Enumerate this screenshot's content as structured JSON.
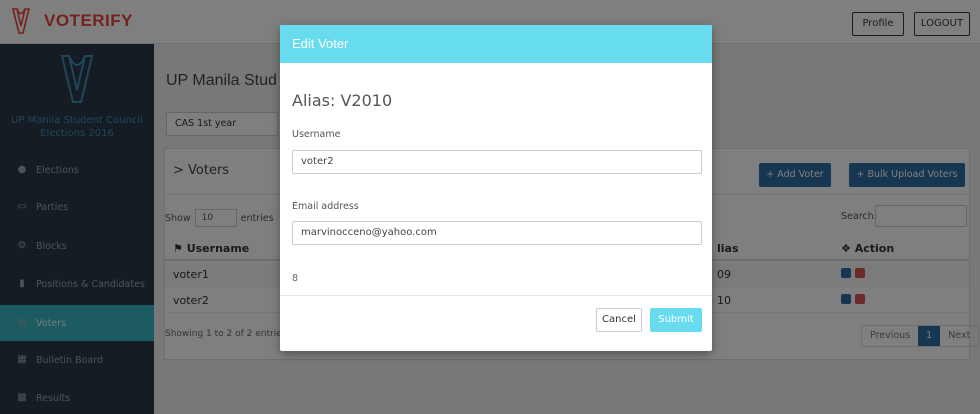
{
  "app": {
    "brand": "VOTERIFY"
  },
  "header": {
    "profile_label": "Profile",
    "logout_label": "LOGOUT"
  },
  "sidebar": {
    "title": "UP Manila Student Council Elections 2016",
    "items": [
      {
        "label": "Elections",
        "icon": "users-icon"
      },
      {
        "label": "Parties",
        "icon": "monitor-icon"
      },
      {
        "label": "Blocks",
        "icon": "cogs-icon"
      },
      {
        "label": "Positions & Candidates",
        "icon": "book-icon"
      },
      {
        "label": "Voters",
        "icon": "id-card-icon",
        "active": true
      },
      {
        "label": "Bulletin Board",
        "icon": "grid-icon"
      },
      {
        "label": "Results",
        "icon": "chart-icon"
      }
    ]
  },
  "main": {
    "heading": "UP Manila Stud",
    "year_select": "CAS 1st year",
    "card_title": "> Voters",
    "add_voter_label": "Add Voter",
    "bulk_upload_label": "Bulk Upload Voters",
    "show_label": "Show",
    "entries_value": "10",
    "entries_label": "entries",
    "search_label": "Search:",
    "columns": {
      "username": "Username",
      "alias": "lias",
      "action": "Action"
    },
    "rows": [
      {
        "username": "voter1",
        "alias": "09"
      },
      {
        "username": "voter2",
        "alias": "10"
      }
    ],
    "showing_text": "Showing 1 to 2 of 2 entries",
    "pager": {
      "previous": "Previous",
      "current": "1",
      "next": "Next"
    }
  },
  "modal": {
    "title": "Edit Voter",
    "alias_heading": "Alias: V2010",
    "username_label": "Username",
    "username_value": "voter2",
    "email_label": "Email address",
    "email_value": "marvinocceno@yahoo.com",
    "note": "8",
    "cancel_label": "Cancel",
    "submit_label": "Submit"
  },
  "colors": {
    "brand_red": "#e8453c",
    "sidebar_bg": "#2c3946",
    "sidebar_active": "#3bb6c4",
    "modal_header": "#67dcee",
    "primary_blue": "#2e6da4",
    "danger_red": "#d9534f"
  }
}
